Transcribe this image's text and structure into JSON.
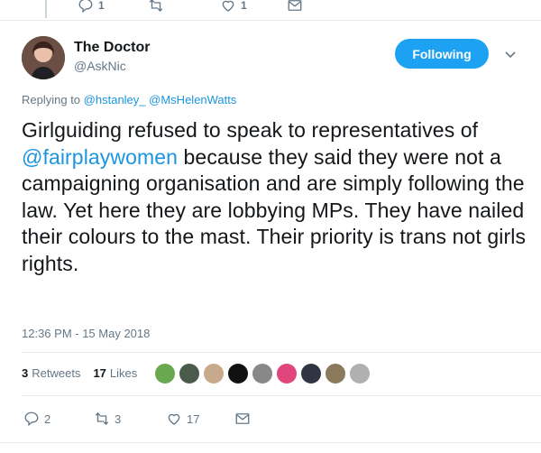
{
  "top_actions": {
    "reply_count": "1",
    "retweet_count": "",
    "like_count": "1"
  },
  "author": {
    "name": "The Doctor",
    "handle": "@AskNic"
  },
  "follow_button": {
    "label": "Following"
  },
  "reply": {
    "prefix": "Replying to",
    "mentions": [
      "@hstanley_",
      "@MsHelenWatts"
    ]
  },
  "tweet": {
    "text_before": "Girlguiding refused to speak to representatives of ",
    "mention": "@fairplaywomen",
    "text_after": " because they said they were not a campaigning organisation and are simply following the law. Yet here they are lobbying MPs. They have nailed their colours to the mast. Their priority is trans not girls rights."
  },
  "timestamp": "12:36 PM - 15 May 2018",
  "stats": {
    "retweets_count": "3",
    "retweets_label": "Retweets",
    "likes_count": "17",
    "likes_label": "Likes"
  },
  "liker_avatars": [
    {
      "icon": "green-avatar",
      "color": "#6aa84f"
    },
    {
      "icon": "landscape-avatar",
      "color": "#4b5b4b"
    },
    {
      "icon": "person-avatar",
      "color": "#c9a98b"
    },
    {
      "icon": "logo-avatar",
      "color": "#111111"
    },
    {
      "icon": "bird-avatar",
      "color": "#888888"
    },
    {
      "icon": "pink-avatar",
      "color": "#e0457b"
    },
    {
      "icon": "person-avatar",
      "color": "#2f3542"
    },
    {
      "icon": "horse-avatar",
      "color": "#8b7a5c"
    },
    {
      "icon": "bw-avatar",
      "color": "#b0b0b0"
    }
  ],
  "bottom_actions": {
    "reply_count": "2",
    "retweet_count": "3",
    "like_count": "17"
  },
  "colors": {
    "accent": "#1da1f2",
    "link": "#1b95e0",
    "muted": "#657786",
    "text": "#14171a"
  }
}
